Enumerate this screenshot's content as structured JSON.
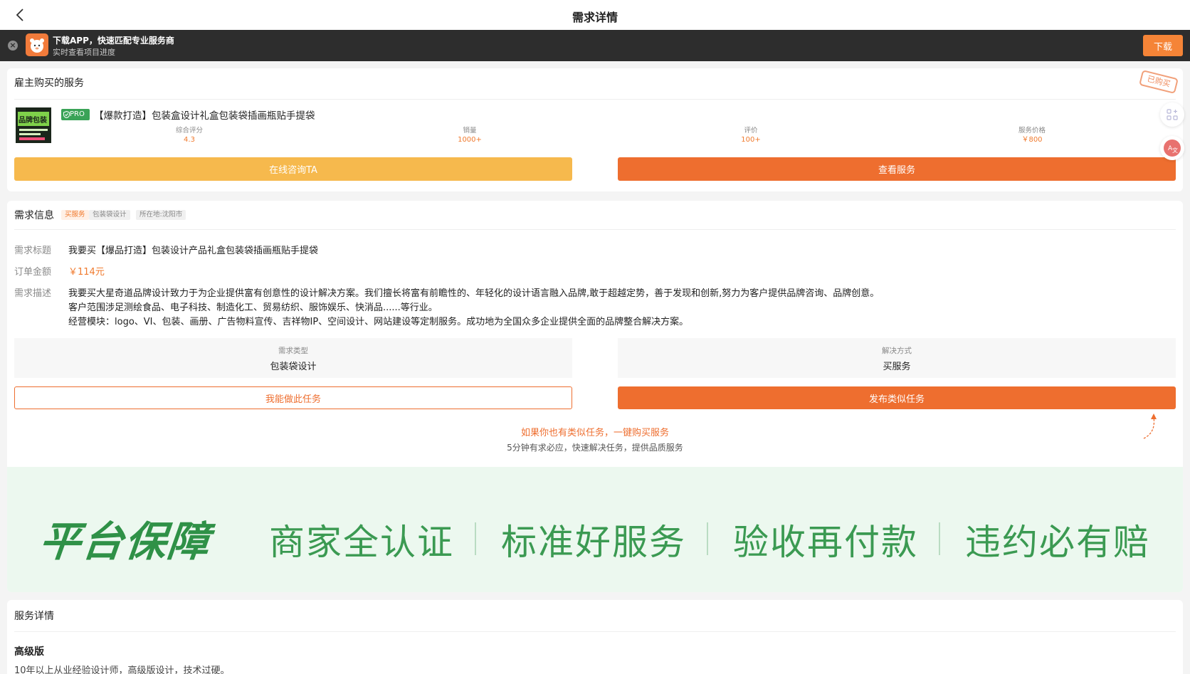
{
  "header": {
    "title": "需求详情"
  },
  "app_banner": {
    "title": "下载APP，快速匹配专业服务商",
    "subtitle": "实时查看项目进度",
    "download_label": "下载"
  },
  "purchased": {
    "section_title": "雇主购买的服务",
    "stamp": "已购买",
    "pro_badge": "PRO",
    "service_title": "【爆款打造】包装盒设计礼盒包装袋插画瓶贴手提袋",
    "thumb_text": "品牌包装",
    "stats": [
      {
        "label": "综合评分",
        "value": "4.3"
      },
      {
        "label": "销量",
        "value": "1000+"
      },
      {
        "label": "评价",
        "value": "100+"
      },
      {
        "label": "服务价格",
        "value": "￥800"
      }
    ],
    "consult_label": "在线咨询TA",
    "view_label": "查看服务"
  },
  "demand": {
    "section_title": "需求信息",
    "tags": [
      "买服务",
      "包装袋设计",
      "所在地:沈阳市"
    ],
    "title_label": "需求标题",
    "title_value": "我要买【爆品打造】包装设计产品礼盒包装袋插画瓶贴手提袋",
    "amount_label": "订单金额",
    "amount_value": "￥114元",
    "desc_label": "需求描述",
    "desc_lines": [
      "我要买大星奇道品牌设计致力于为企业提供富有创意性的设计解决方案。我们擅长将富有前瞻性的、年轻化的设计语言融入品牌,敢于超越定势，善于发现和创新,努力为客户提供品牌咨询、品牌创意。",
      "客户范围涉足测绘食品、电子科技、制造化工、贸易纺织、服饰娱乐、快消品......等行业。",
      "经营模块：logo、VI、包装、画册、广告物料宣传、吉祥物IP、空间设计、网站建设等定制服务。成功地为全国众多企业提供全面的品牌整合解决方案。"
    ],
    "type_label": "需求类型",
    "type_value": "包装袋设计",
    "method_label": "解决方式",
    "method_value": "买服务",
    "can_do_label": "我能做此任务",
    "publish_label": "发布类似任务",
    "promo_main": "如果你也有类似任务，一键购买服务",
    "promo_sub": "5分钟有求必应，快速解决任务，提供品质服务"
  },
  "guarantee": {
    "main": "平台保障",
    "items": [
      "商家全认证",
      "标准好服务",
      "验收再付款",
      "违约必有赔"
    ]
  },
  "service_detail": {
    "section_title": "服务详情",
    "grade_title": "高级版",
    "grade_desc": "10年以上从业经验设计师，高级版设计，技术过硬。"
  },
  "colors": {
    "accent_orange": "#ee6e2f",
    "accent_yellow": "#f6b94d",
    "guarantee_green": "#2f9147"
  },
  "icons": [
    "back-icon",
    "close-icon",
    "app-logo-icon",
    "grid-icon",
    "translate-icon",
    "curved-arrow-icon",
    "shield-icon"
  ]
}
